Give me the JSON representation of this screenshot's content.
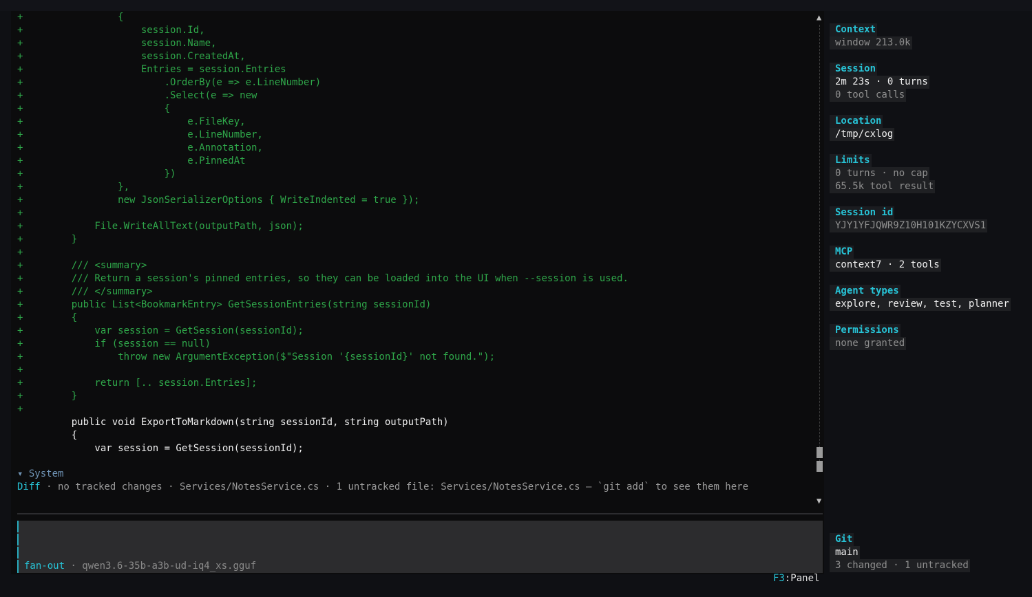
{
  "code_lines": [
    {
      "m": "+",
      "t": "            {",
      "k": "add"
    },
    {
      "m": "+",
      "t": "                session.Id,",
      "k": "add"
    },
    {
      "m": "+",
      "t": "                session.Name,",
      "k": "add"
    },
    {
      "m": "+",
      "t": "                session.CreatedAt,",
      "k": "add"
    },
    {
      "m": "+",
      "t": "                Entries = session.Entries",
      "k": "add"
    },
    {
      "m": "+",
      "t": "                    .OrderBy(e => e.LineNumber)",
      "k": "add"
    },
    {
      "m": "+",
      "t": "                    .Select(e => new",
      "k": "add"
    },
    {
      "m": "+",
      "t": "                    {",
      "k": "add"
    },
    {
      "m": "+",
      "t": "                        e.FileKey,",
      "k": "add"
    },
    {
      "m": "+",
      "t": "                        e.LineNumber,",
      "k": "add"
    },
    {
      "m": "+",
      "t": "                        e.Annotation,",
      "k": "add"
    },
    {
      "m": "+",
      "t": "                        e.PinnedAt",
      "k": "add"
    },
    {
      "m": "+",
      "t": "                    })",
      "k": "add"
    },
    {
      "m": "+",
      "t": "            },",
      "k": "add"
    },
    {
      "m": "+",
      "t": "            new JsonSerializerOptions { WriteIndented = true });",
      "k": "add"
    },
    {
      "m": "+",
      "t": "",
      "k": "add"
    },
    {
      "m": "+",
      "t": "        File.WriteAllText(outputPath, json);",
      "k": "add"
    },
    {
      "m": "+",
      "t": "    }",
      "k": "add"
    },
    {
      "m": "+",
      "t": "",
      "k": "add"
    },
    {
      "m": "+",
      "t": "    /// <summary>",
      "k": "add"
    },
    {
      "m": "+",
      "t": "    /// Return a session's pinned entries, so they can be loaded into the UI when --session is used.",
      "k": "add"
    },
    {
      "m": "+",
      "t": "    /// </summary>",
      "k": "add"
    },
    {
      "m": "+",
      "t": "    public List<BookmarkEntry> GetSessionEntries(string sessionId)",
      "k": "add"
    },
    {
      "m": "+",
      "t": "    {",
      "k": "add"
    },
    {
      "m": "+",
      "t": "        var session = GetSession(sessionId);",
      "k": "add"
    },
    {
      "m": "+",
      "t": "        if (session == null)",
      "k": "add"
    },
    {
      "m": "+",
      "t": "            throw new ArgumentException($\"Session '{sessionId}' not found.\");",
      "k": "add"
    },
    {
      "m": "+",
      "t": "",
      "k": "add"
    },
    {
      "m": "+",
      "t": "        return [.. session.Entries];",
      "k": "add"
    },
    {
      "m": "+",
      "t": "    }",
      "k": "add"
    },
    {
      "m": "+",
      "t": "",
      "k": "add"
    },
    {
      "m": " ",
      "t": "    public void ExportToMarkdown(string sessionId, string outputPath)",
      "k": "ctx"
    },
    {
      "m": " ",
      "t": "    {",
      "k": "ctx"
    },
    {
      "m": " ",
      "t": "        var session = GetSession(sessionId);",
      "k": "ctx"
    }
  ],
  "system_header": "▾ System",
  "diff": {
    "label": "Diff",
    "text": " · no tracked changes · Services/NotesService.cs · 1 untracked file: Services/NotesService.cs — `git add` to see them here"
  },
  "scroll": {
    "up_arrow": "▲",
    "down_arrow": "▼",
    "position_fraction": 0.97
  },
  "input": {
    "mode": "fan-out",
    "model": " · qwen3.6-35b-a3b-ud-iq4_xs.gguf"
  },
  "f3": {
    "key": "F3",
    "label": ":Panel"
  },
  "panel": {
    "context": {
      "title": "Context",
      "window": "window 213.0k"
    },
    "session": {
      "title": "Session",
      "stats": "2m 23s · 0 turns",
      "tools": "0 tool calls"
    },
    "location": {
      "title": "Location",
      "path": "/tmp/cxlog"
    },
    "limits": {
      "title": "Limits",
      "turns": "0 turns · no cap",
      "tool_result": "65.5k tool result"
    },
    "session_id": {
      "title": "Session id",
      "value": "YJY1YFJQWR9Z10H101KZYCXVS1"
    },
    "mcp": {
      "title": "MCP",
      "value": "context7 · 2 tools"
    },
    "agent_types": {
      "title": "Agent types",
      "value": "explore, review, test, planner"
    },
    "permissions": {
      "title": "Permissions",
      "value": "none granted"
    },
    "git": {
      "title": "Git",
      "branch": "main",
      "changes": "3 changed · 1 untracked"
    }
  },
  "colors": {
    "accent": "#27c3d6",
    "added_line": "#2fa84a",
    "background": "#0c0c0d"
  }
}
